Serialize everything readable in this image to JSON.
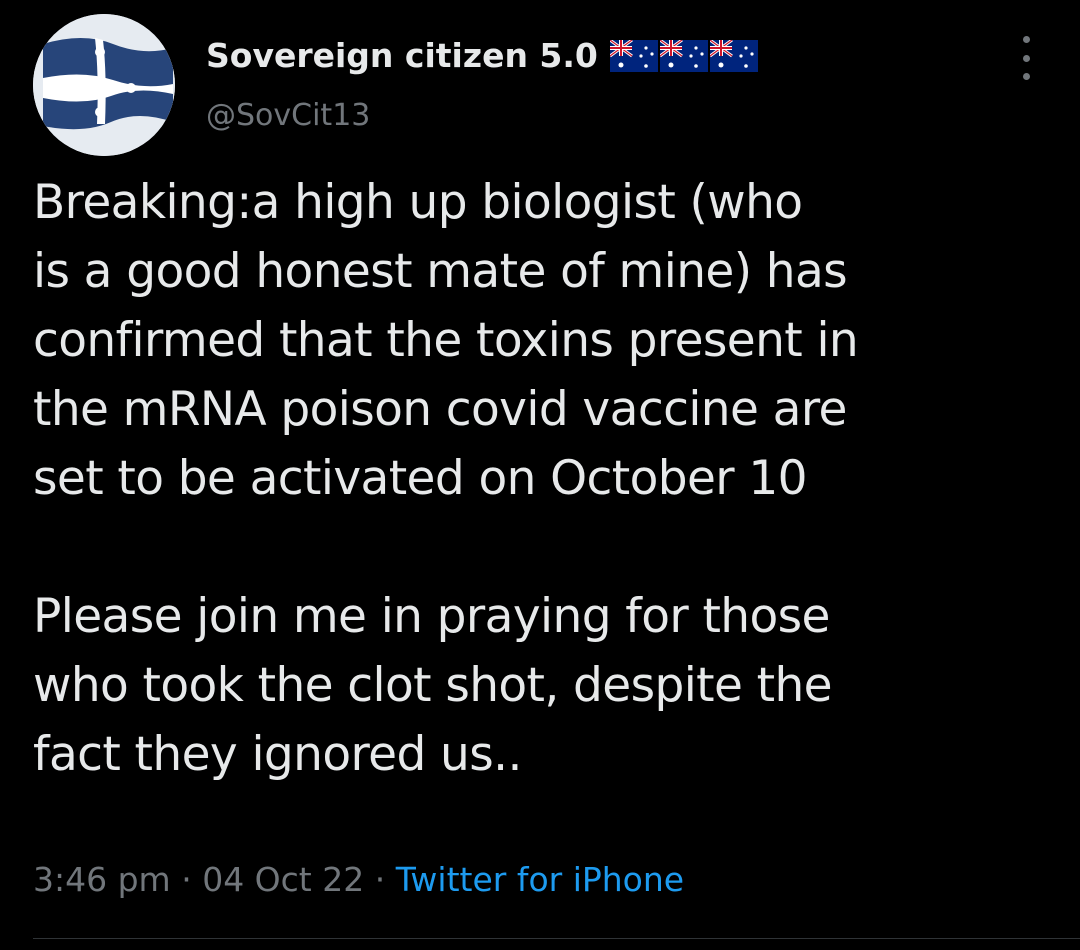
{
  "user": {
    "display_name": "Sovereign citizen 5.0",
    "handle": "@SovCit13",
    "avatar_icon": "eureka-flag-avatar",
    "name_badges": [
      "australia-flag-icon",
      "australia-flag-icon",
      "australia-flag-icon"
    ]
  },
  "tweet": {
    "lines": [
      "Breaking:a high up biologist (who",
      "is a good honest mate of mine) has",
      "confirmed that the toxins present in",
      "the mRNA poison covid vaccine are",
      "set to be activated on October 10",
      "",
      "Please join me in praying for those",
      "who took the clot shot, despite the",
      "fact they ignored us.."
    ]
  },
  "meta": {
    "time": "3:46 pm",
    "separator": "·",
    "date": "04 Oct 22",
    "source": "Twitter for iPhone"
  },
  "colors": {
    "background": "#000000",
    "text": "#e7e9ea",
    "muted": "#71767b",
    "link": "#1d9bf0"
  }
}
